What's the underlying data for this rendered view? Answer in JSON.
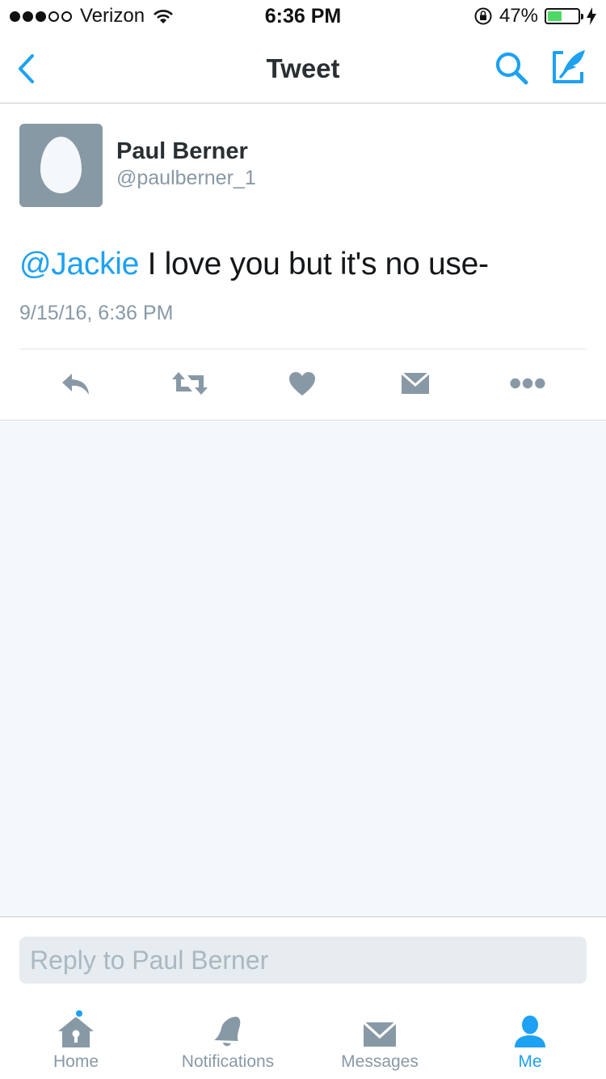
{
  "status_bar": {
    "carrier": "Verizon",
    "signal_bars_filled": 3,
    "signal_bars_total": 5,
    "time": "6:36 PM",
    "battery_percent": "47%",
    "battery_level": 0.47
  },
  "nav": {
    "title": "Tweet",
    "back_icon": "chevron-left-icon",
    "search_icon": "search-icon",
    "compose_icon": "compose-icon"
  },
  "tweet": {
    "author_name": "Paul Berner",
    "author_handle": "@paulberner_1",
    "mention": "@Jackie",
    "text": " I love you but it's no use-",
    "timestamp": "9/15/16, 6:36 PM",
    "actions": [
      "reply-icon",
      "retweet-icon",
      "like-icon",
      "direct-message-icon",
      "more-icon"
    ]
  },
  "reply": {
    "placeholder": "Reply to Paul Berner"
  },
  "tabs": [
    {
      "label": "Home",
      "icon": "home-icon",
      "has_badge": true
    },
    {
      "label": "Notifications",
      "icon": "bell-icon"
    },
    {
      "label": "Messages",
      "icon": "envelope-icon"
    },
    {
      "label": "Me",
      "icon": "person-icon",
      "active": true
    }
  ],
  "colors": {
    "accent": "#1da1f2",
    "icon_gray": "#8899a6",
    "background": "#f5f8fa",
    "battery_green": "#4cd964"
  }
}
